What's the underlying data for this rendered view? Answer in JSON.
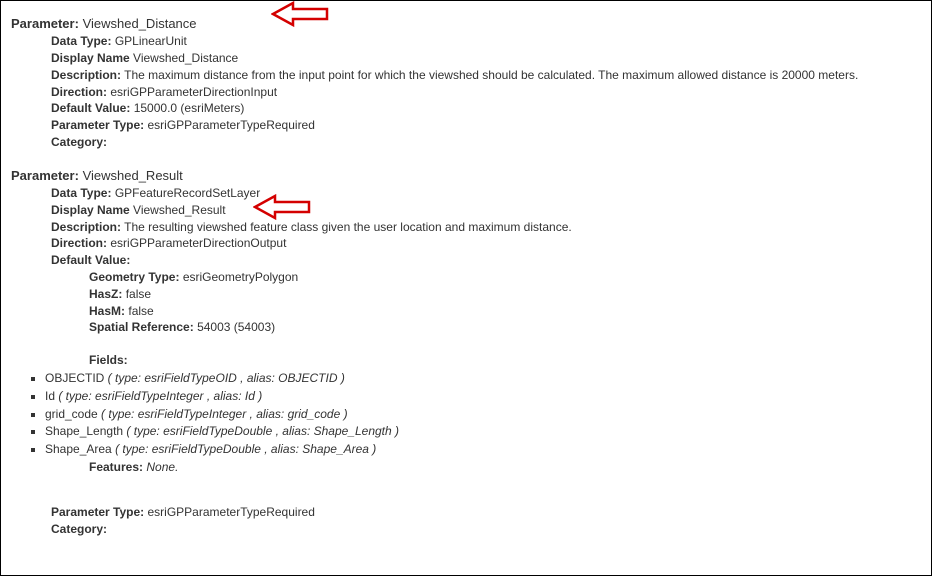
{
  "param1": {
    "header_label": "Parameter:",
    "name": "Viewshed_Distance",
    "dataType_label": "Data Type:",
    "dataType": "GPLinearUnit",
    "displayName_label": "Display Name",
    "displayName": "Viewshed_Distance",
    "description_label": "Description:",
    "description": "The maximum distance from the input point for which the viewshed should be calculated. The maximum allowed distance is 20000 meters.",
    "direction_label": "Direction:",
    "direction": "esriGPParameterDirectionInput",
    "defaultValue_label": "Default Value:",
    "defaultValue": "15000.0   (esriMeters)",
    "paramType_label": "Parameter Type:",
    "paramType": "esriGPParameterTypeRequired",
    "category_label": "Category:"
  },
  "param2": {
    "header_label": "Parameter:",
    "name": "Viewshed_Result",
    "dataType_label": "Data Type:",
    "dataType": "GPFeatureRecordSetLayer",
    "displayName_label": "Display Name",
    "displayName": "Viewshed_Result",
    "description_label": "Description:",
    "description": "The resulting viewshed feature class given the user location and maximum distance.",
    "direction_label": "Direction:",
    "direction": "esriGPParameterDirectionOutput",
    "defaultValue_label": "Default Value:",
    "geometryType_label": "Geometry Type:",
    "geometryType": "esriGeometryPolygon",
    "hasZ_label": "HasZ:",
    "hasZ": "false",
    "hasM_label": "HasM:",
    "hasM": "false",
    "spatialRef_label": "Spatial Reference:",
    "spatialRef": "54003  (54003)",
    "fields_label": "Fields:",
    "fields": [
      {
        "name": "OBJECTID",
        "details": "( type: esriFieldTypeOID , alias: OBJECTID )"
      },
      {
        "name": "Id",
        "details": "( type: esriFieldTypeInteger , alias: Id )"
      },
      {
        "name": "grid_code",
        "details": "( type: esriFieldTypeInteger , alias: grid_code )"
      },
      {
        "name": "Shape_Length",
        "details": "( type: esriFieldTypeDouble , alias: Shape_Length )"
      },
      {
        "name": "Shape_Area",
        "details": "( type: esriFieldTypeDouble , alias: Shape_Area )"
      }
    ],
    "features_label": "Features:",
    "features": "None.",
    "paramType_label": "Parameter Type:",
    "paramType": "esriGPParameterTypeRequired",
    "category_label": "Category:"
  }
}
